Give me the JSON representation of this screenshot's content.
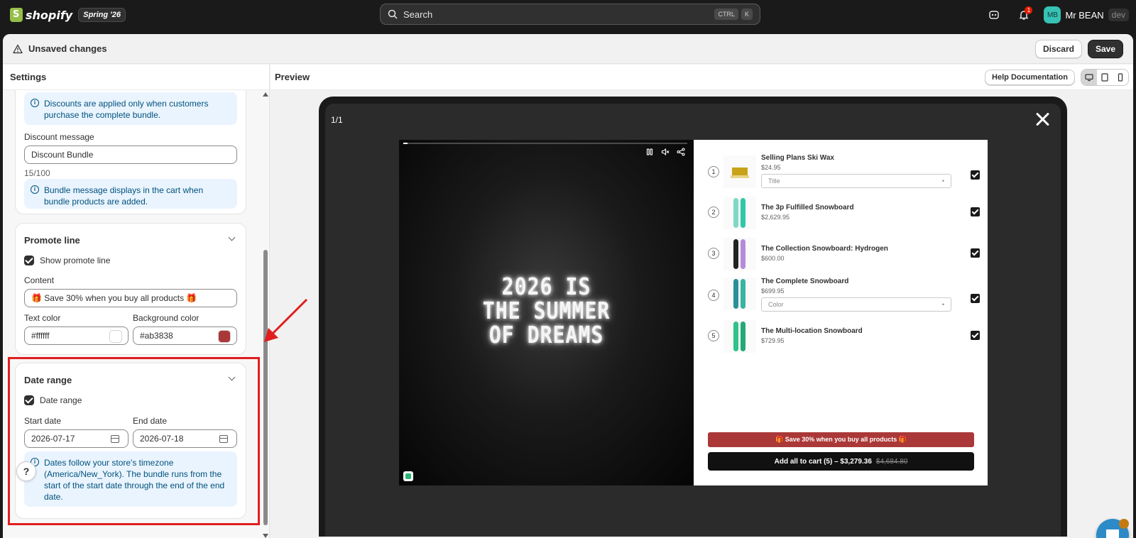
{
  "topbar": {
    "logo_text": "shopify",
    "edition": "Spring '26",
    "search_placeholder": "Search",
    "kbd_ctrl": "CTRL",
    "kbd_k": "K",
    "notification_count": "1",
    "user_initials": "MB",
    "user_name": "Mr BEAN",
    "user_tag": "dev"
  },
  "unsaved_bar": {
    "title": "Unsaved changes",
    "discard_label": "Discard",
    "save_label": "Save"
  },
  "settings": {
    "title": "Settings",
    "discount_info": "Discounts are applied only when customers purchase the complete bundle.",
    "discount_message_label": "Discount message",
    "discount_message_value": "Discount Bundle",
    "discount_message_count": "15/100",
    "bundle_info": "Bundle message displays in the cart when bundle products are added.",
    "promote": {
      "title": "Promote line",
      "show_label": "Show promote line",
      "show_checked": true,
      "content_label": "Content",
      "content_value": "🎁 Save 30% when you buy all products 🎁",
      "text_color_label": "Text color",
      "text_color_value": "#ffffff",
      "bg_color_label": "Background color",
      "bg_color_value": "#ab3838"
    },
    "date_range": {
      "title": "Date range",
      "toggle_label": "Date range",
      "toggle_checked": true,
      "start_label": "Start date",
      "start_value": "2026-07-17",
      "end_label": "End date",
      "end_value": "2026-07-18",
      "info": "Dates follow your store's timezone (America/New_York). The bundle runs from the start of the start date through the end of the end date."
    }
  },
  "preview": {
    "title": "Preview",
    "help_doc_label": "Help Documentation",
    "counter": "1/1",
    "video_text_line1": "2026 IS",
    "video_text_line2": "THE SUMMER",
    "video_text_line3": "OF DREAMS",
    "products": [
      {
        "num": "1",
        "name": "Selling Plans Ski Wax",
        "price": "$24.95",
        "select": "Title"
      },
      {
        "num": "2",
        "name": "The 3p Fulfilled Snowboard",
        "price": "$2,629.95"
      },
      {
        "num": "3",
        "name": "The Collection Snowboard: Hydrogen",
        "price": "$600.00"
      },
      {
        "num": "4",
        "name": "The Complete Snowboard",
        "price": "$699.95",
        "select": "Color"
      },
      {
        "num": "5",
        "name": "The Multi-location Snowboard",
        "price": "$729.95"
      }
    ],
    "promo_text": "🎁 Save 30% when you buy all products 🎁",
    "cart_label": "Add all to cart (5) – $3,279.36",
    "cart_old_price": "$4,684.80"
  },
  "colors": {
    "promo_bg": "#ab3838",
    "text_color": "#ffffff",
    "avatar": "#36c2b4",
    "chat": "#2c8ac7"
  }
}
